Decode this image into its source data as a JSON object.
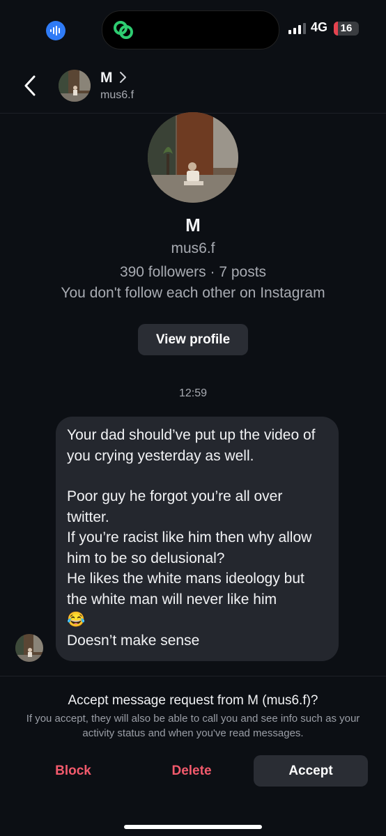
{
  "status_bar": {
    "network": "4G",
    "battery": "16",
    "battery_level": 0.16,
    "battery_color": "#e5434f",
    "recording_icon": "sound-wave-icon",
    "island_icon": "link-rings-icon",
    "island_icon_color": "#2ecc71"
  },
  "header": {
    "back_icon": "chevron-left-icon",
    "name": "M",
    "handle": "mus6.f"
  },
  "profile": {
    "name": "M",
    "handle": "mus6.f",
    "stats": "390 followers · 7 posts",
    "note": "You don't follow each other on Instagram",
    "view_profile_label": "View profile"
  },
  "conversation": {
    "timestamp": "12:59",
    "message": {
      "line1": "Your dad should’ve put up the video of you crying yesterday as well.",
      "line2": "Poor guy he forgot you’re all over twitter.",
      "line3": "If you’re racist like him then why allow him to be so delusional?",
      "line4": "He likes the white mans ideology but the white man will never like him",
      "emoji": "😂",
      "line5": "Doesn’t make sense"
    }
  },
  "request": {
    "title": "Accept message request from M (mus6.f)?",
    "info": "If you accept, they will also be able to call you and see info such as your activity status and when you've read messages.",
    "block_label": "Block",
    "delete_label": "Delete",
    "accept_label": "Accept",
    "danger_color": "#f25a6c"
  }
}
